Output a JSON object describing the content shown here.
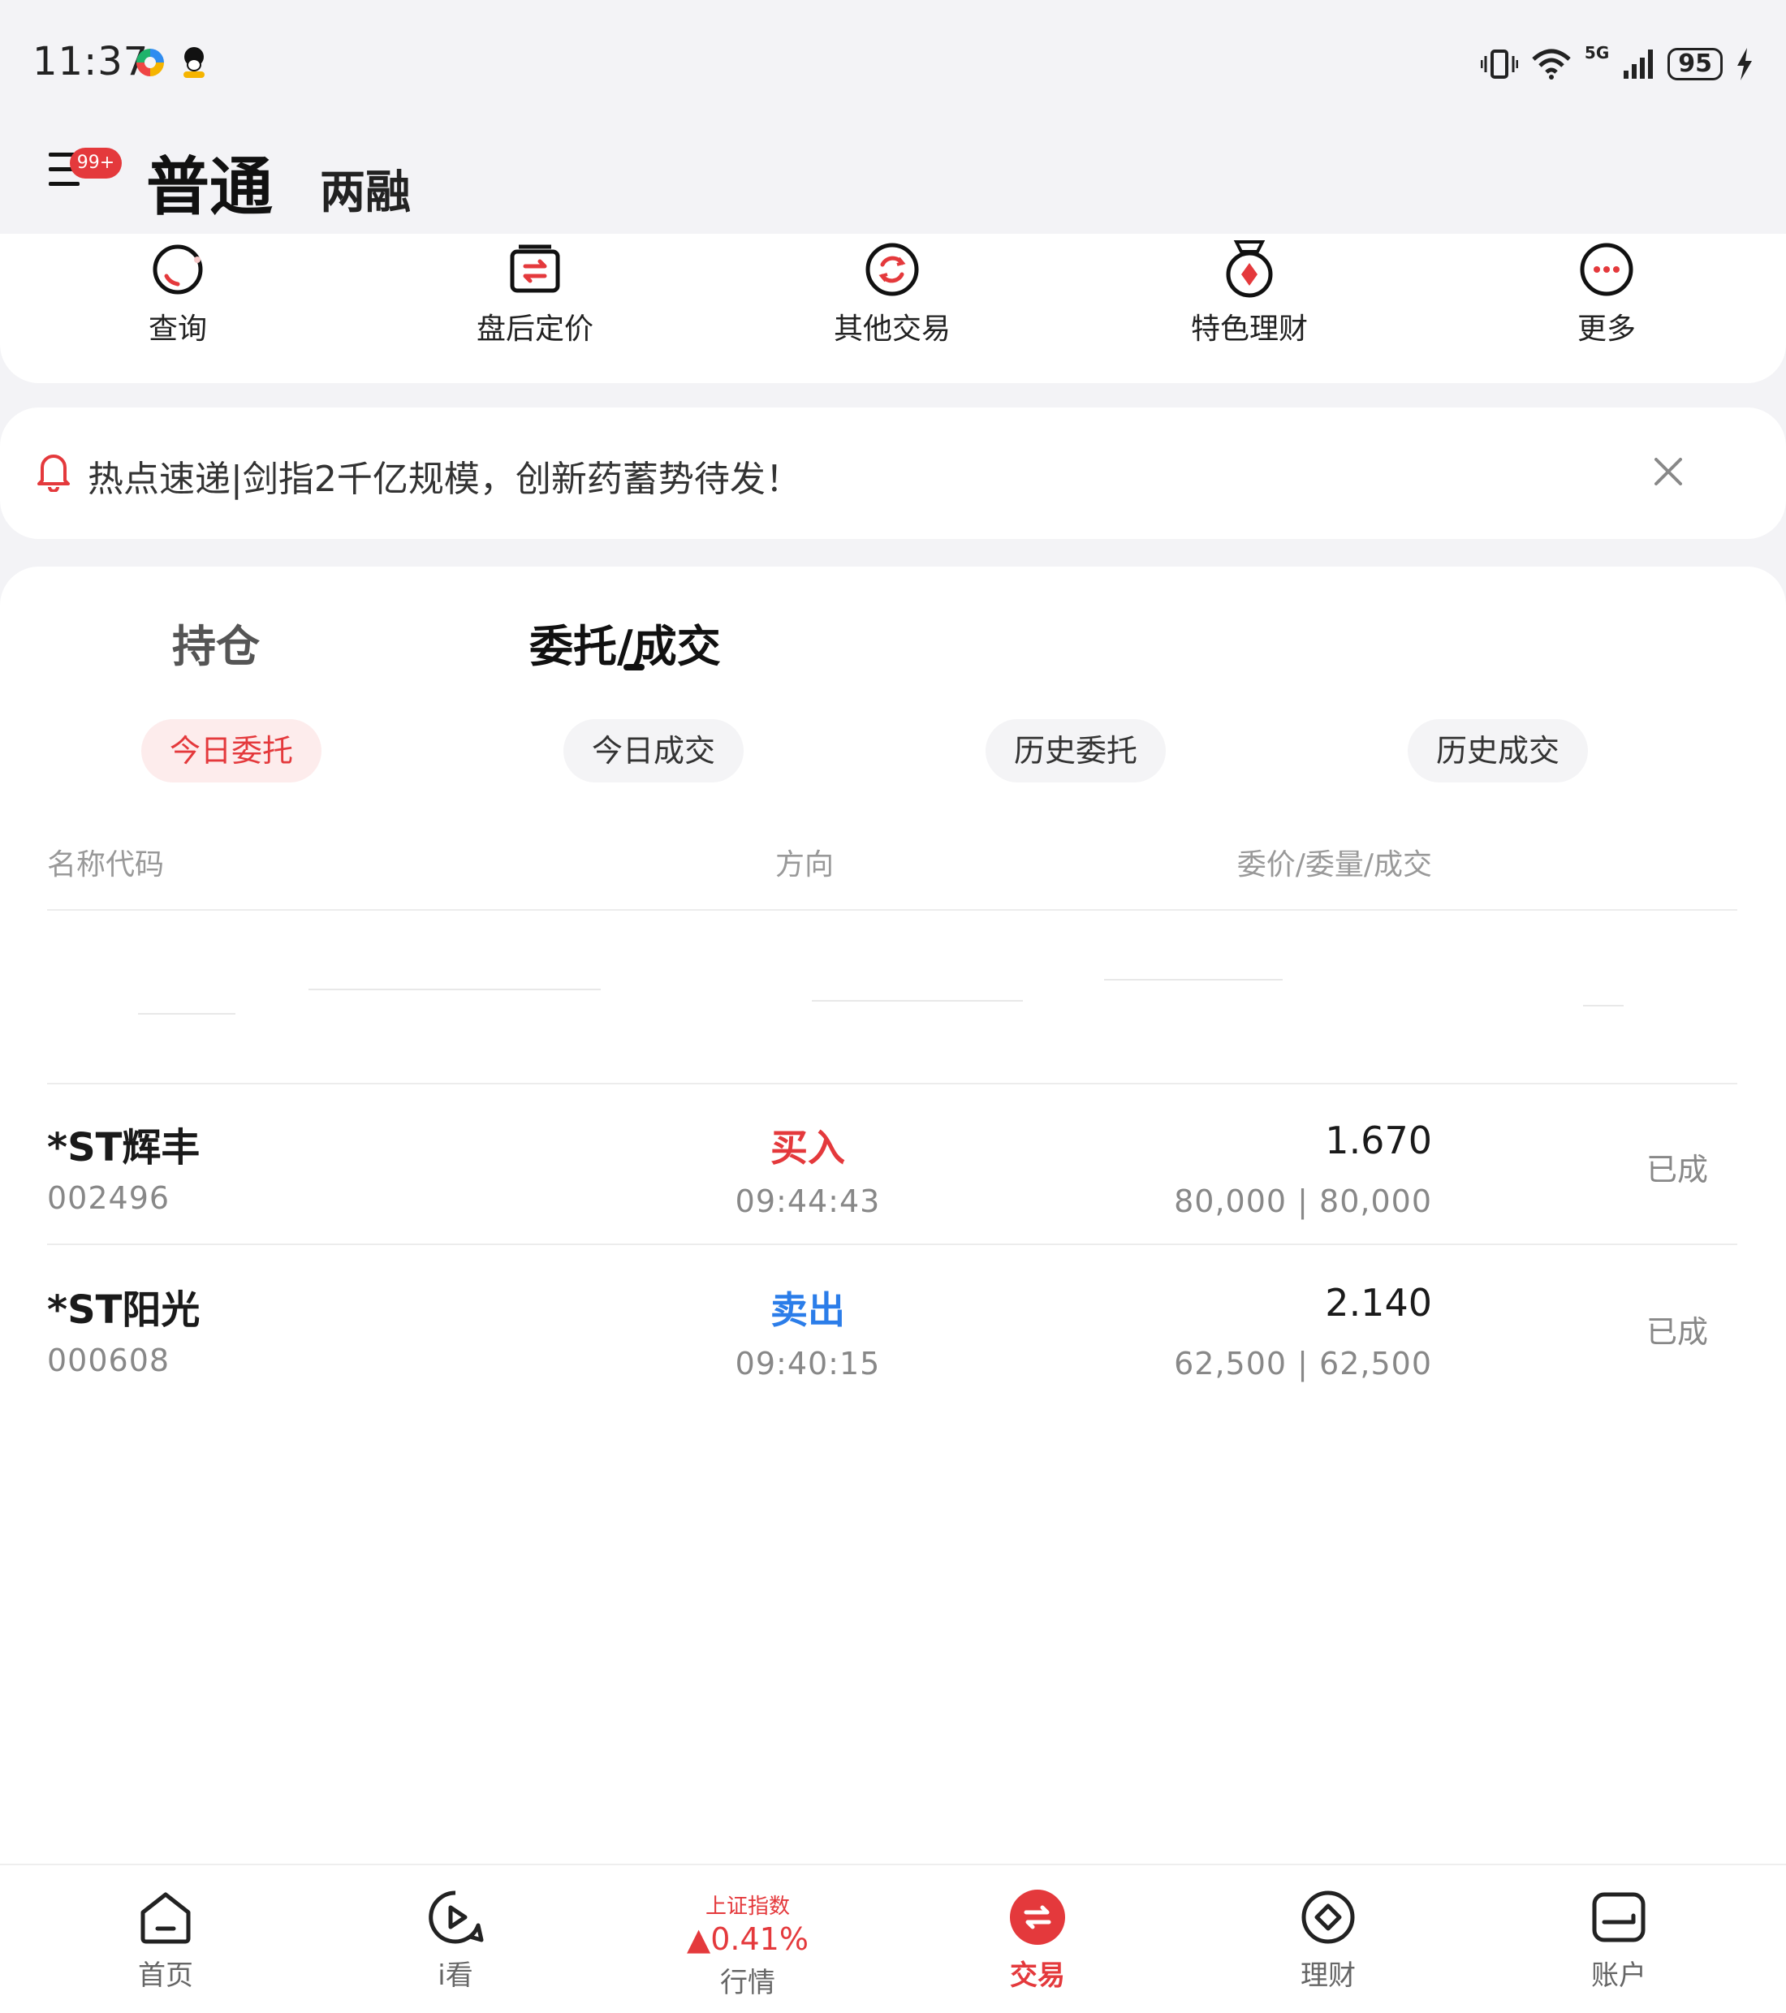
{
  "status_bar": {
    "time": "11:37",
    "network": "5G",
    "battery": "95",
    "icons": [
      "vibrate-icon",
      "wifi-icon",
      "signal-icon",
      "charging-icon"
    ]
  },
  "header": {
    "badge": "99+",
    "tabs": [
      {
        "label": "普通",
        "active": true
      },
      {
        "label": "两融",
        "active": false
      }
    ]
  },
  "quick_actions": [
    {
      "label": "查询",
      "icon": "search-icon"
    },
    {
      "label": "盘后定价",
      "icon": "transfer-icon"
    },
    {
      "label": "其他交易",
      "icon": "refresh-icon"
    },
    {
      "label": "特色理财",
      "icon": "medal-icon"
    },
    {
      "label": "更多",
      "icon": "more-icon"
    }
  ],
  "notice": {
    "text": "热点速递|剑指2千亿规模，创新药蓄势待发！"
  },
  "segments": [
    {
      "label": "持仓",
      "active": false
    },
    {
      "label": "委托/成交",
      "active": true
    }
  ],
  "filters": [
    {
      "label": "今日委托",
      "active": true
    },
    {
      "label": "今日成交",
      "active": false
    },
    {
      "label": "历史委托",
      "active": false
    },
    {
      "label": "历史成交",
      "active": false
    }
  ],
  "columns": {
    "name": "名称代码",
    "direction": "方向",
    "price": "委价/委量/成交"
  },
  "orders": [
    {
      "name": "*ST辉丰",
      "code": "002496",
      "direction": "买入",
      "side": "buy",
      "time": "09:44:43",
      "price": "1.670",
      "quantity": "80,000 | 80,000",
      "status": "已成"
    },
    {
      "name": "*ST阳光",
      "code": "000608",
      "direction": "卖出",
      "side": "sell",
      "time": "09:40:15",
      "price": "2.140",
      "quantity": "62,500 | 62,500",
      "status": "已成"
    }
  ],
  "bottom_nav": [
    {
      "label": "首页",
      "icon": "home-icon",
      "active": false
    },
    {
      "label": "i看",
      "icon": "play-icon",
      "active": false
    },
    {
      "label": "行情",
      "index_name": "上证指数",
      "index_value": "▲0.41%",
      "active": false
    },
    {
      "label": "交易",
      "icon": "trade-icon",
      "active": true
    },
    {
      "label": "理财",
      "icon": "wealth-icon",
      "active": false
    },
    {
      "label": "账户",
      "icon": "account-icon",
      "active": false
    }
  ],
  "colors": {
    "accent": "#e4393c",
    "sell": "#2b7de9",
    "background": "#f3f3f6"
  }
}
